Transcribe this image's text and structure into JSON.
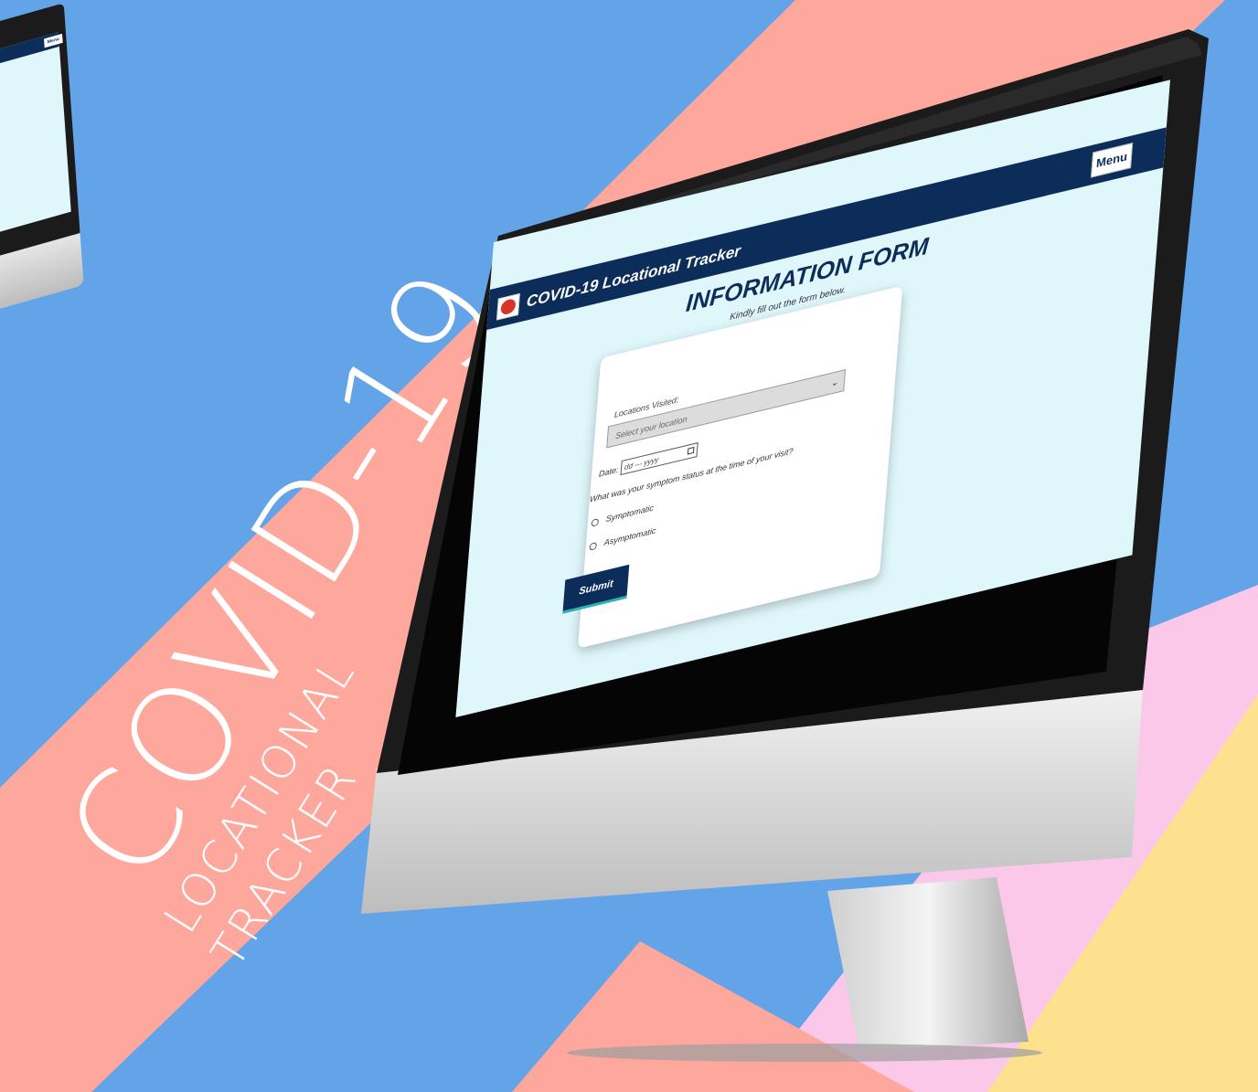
{
  "poster": {
    "title": "COVID-19",
    "subtitle_line1": "LOCATIONAL",
    "subtitle_line2": "TRACKER"
  },
  "colors": {
    "background_blue": "#63a3e8",
    "salmon": "#fda79d",
    "pink": "#fbc8ea",
    "yellow": "#fde18f",
    "navbar": "#0c2d5a",
    "screen_bg": "#dff7fb",
    "submit_accent": "#2bb5b5"
  },
  "small_monitor": {
    "menu_label": "Menu"
  },
  "app": {
    "nav_title": "COVID-19 Locational Tracker",
    "logo_icon": "virus-logo-icon",
    "menu_label": "Menu",
    "form_title": "INFORMATION FORM",
    "form_subtitle": "Kindly fill out the form below.",
    "locations_label": "Locations Visited:",
    "locations_placeholder": "Select your location",
    "date_label": "Date:",
    "date_placeholder": "dd --- yyyy",
    "symptom_question": "What was your symptom status at the time of your visit?",
    "options": [
      "Symptomatic",
      "Asymptomatic"
    ],
    "submit_label": "Submit"
  }
}
